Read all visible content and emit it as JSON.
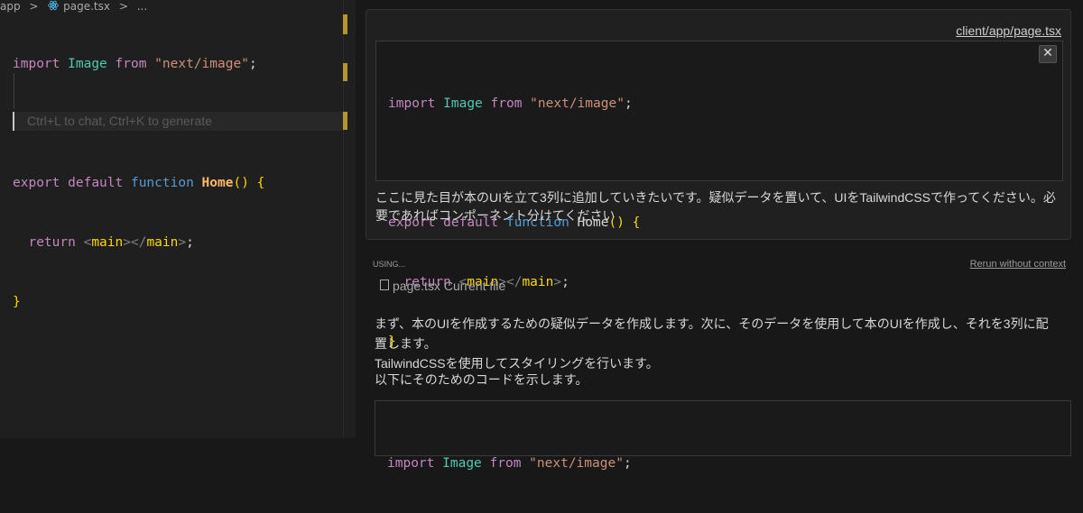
{
  "editor": {
    "breadcrumb": {
      "folder": "app",
      "sep1": ">",
      "file": "page.tsx",
      "sep2": ">",
      "more": "..."
    },
    "code": {
      "line1": {
        "kw": "import",
        "name": "Image",
        "from": "from",
        "str": "\"next/image\"",
        "semi": ";"
      },
      "line3": {
        "export": "export",
        "default": "default",
        "function": "function",
        "name": "Home",
        "paren": "()",
        "brace": "{"
      },
      "line4": {
        "ret": "return",
        "open": "<",
        "tag1": "main",
        "mid": "></",
        "tag2": "main",
        "close": ">",
        "semi": ";"
      },
      "line5": {
        "brace": "}"
      }
    },
    "hint": "Ctrl+L to chat, Ctrl+K to generate"
  },
  "chat": {
    "file_link": "client/app/page.tsx",
    "close_label": "✕",
    "prompt_text": "ここに見た目が本のUIを立て3列に追加していきたいです。疑似データを置いて、UIをTailwindCSSで作ってください。必要であればコンポーネント分けてください",
    "using_label": "USING...",
    "rerun_label": "Rerun without context",
    "context_file": "page.tsx",
    "context_desc": "Current file",
    "answer_line1": "まず、本のUIを作成するための疑似データを作成します。次に、そのデータを使用して本のUIを作成し、それを3列に配置します。",
    "answer_line2": "TailwindCSSを使用してスタイリングを行います。",
    "answer_line3": "以下にそのためのコードを示します。"
  },
  "colors": {
    "keyword": "#569cd6",
    "string": "#ce9178",
    "type": "#4ec9b0",
    "bracket": "#ffd700",
    "background": "#181818"
  }
}
